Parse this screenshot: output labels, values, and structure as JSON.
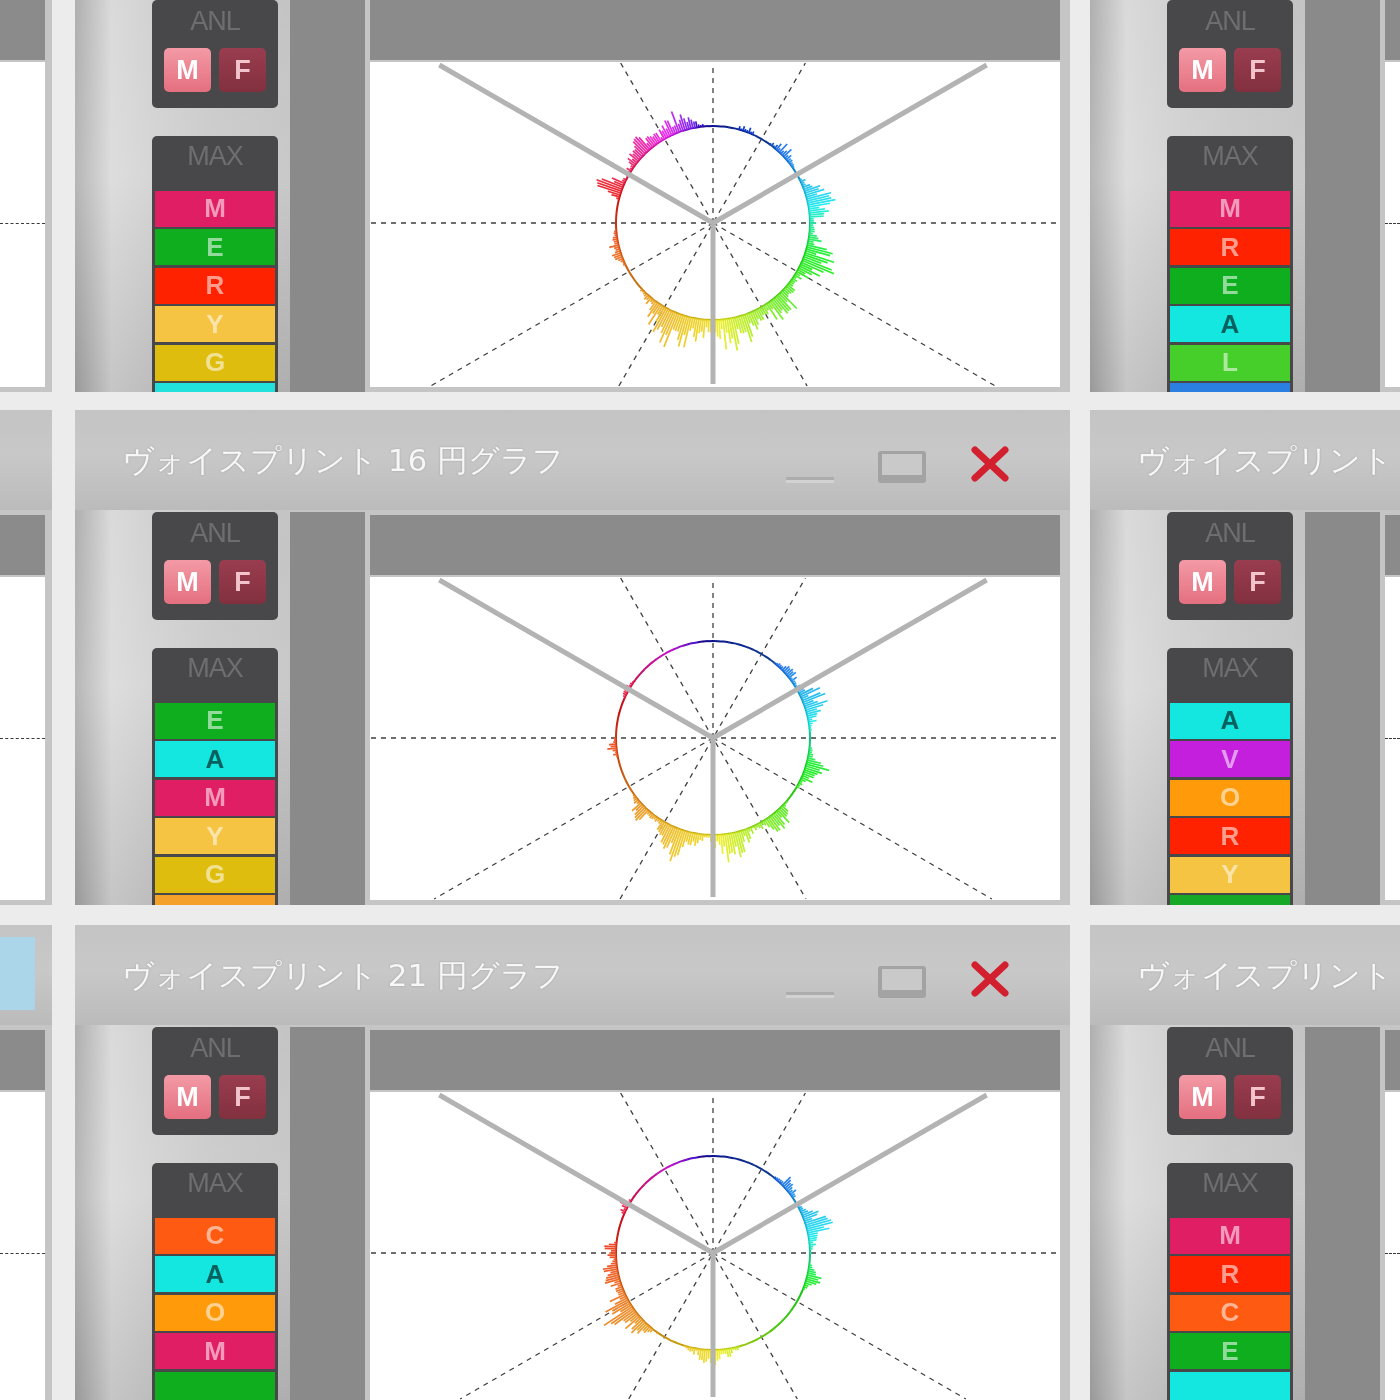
{
  "rows": [
    {
      "windows": [
        {
          "anl": {
            "label": "ANL",
            "options": [
              {
                "label": "M",
                "selected": true
              },
              {
                "label": "F",
                "selected": false
              }
            ]
          },
          "max": {
            "label": "MAX",
            "items": [
              {
                "label": "M",
                "color": "#e01e64"
              },
              {
                "label": "E",
                "color": "#0fae1e"
              },
              {
                "label": "R",
                "color": "#ff2200"
              },
              {
                "label": "Y",
                "color": "#f5c443"
              },
              {
                "label": "G",
                "color": "#dfbd0e"
              },
              {
                "color": "#22e0dc"
              }
            ]
          }
        },
        {
          "anl": {
            "label": "ANL",
            "options": [
              {
                "label": "M",
                "selected": true
              },
              {
                "label": "F",
                "selected": false
              }
            ]
          },
          "max": {
            "label": "MAX",
            "items": [
              {
                "label": "M",
                "color": "#e01e64"
              },
              {
                "label": "R",
                "color": "#ff2200"
              },
              {
                "label": "E",
                "color": "#0fae1e"
              },
              {
                "label": "A",
                "color": "#14e6e0"
              },
              {
                "label": "L",
                "color": "#46cf2a"
              },
              {
                "color": "#2a7fe0"
              }
            ]
          }
        }
      ]
    },
    {
      "left_title_bar": {
        "highlighted": false
      },
      "windows": [
        {
          "title": "ヴォイスプリント 16 円グラフ",
          "anl": {
            "label": "ANL",
            "options": [
              {
                "label": "M",
                "selected": true
              },
              {
                "label": "F",
                "selected": false
              }
            ]
          },
          "max": {
            "label": "MAX",
            "items": [
              {
                "label": "E",
                "color": "#0fae1e"
              },
              {
                "label": "A",
                "color": "#14e6e0"
              },
              {
                "label": "M",
                "color": "#e01e64"
              },
              {
                "label": "Y",
                "color": "#f5c443"
              },
              {
                "label": "G",
                "color": "#dfbd0e"
              },
              {
                "color": "#f4a12c"
              }
            ]
          }
        },
        {
          "title": "ヴォイスプリント",
          "anl": {
            "label": "ANL",
            "options": [
              {
                "label": "M",
                "selected": true
              },
              {
                "label": "F",
                "selected": false
              }
            ]
          },
          "max": {
            "label": "MAX",
            "items": [
              {
                "label": "A",
                "color": "#14e6e0"
              },
              {
                "label": "V",
                "color": "#c41fdc"
              },
              {
                "label": "O",
                "color": "#ff9a0a"
              },
              {
                "label": "R",
                "color": "#ff2200"
              },
              {
                "label": "Y",
                "color": "#f5c443"
              },
              {
                "color": "#18a828"
              }
            ]
          }
        }
      ]
    },
    {
      "left_title_bar": {
        "highlighted": true
      },
      "windows": [
        {
          "title": "ヴォイスプリント 21 円グラフ",
          "anl": {
            "label": "ANL",
            "options": [
              {
                "label": "M",
                "selected": true
              },
              {
                "label": "F",
                "selected": false
              }
            ]
          },
          "max": {
            "label": "MAX",
            "items": [
              {
                "label": "C",
                "color": "#ff5a12"
              },
              {
                "label": "A",
                "color": "#14e6e0"
              },
              {
                "label": "O",
                "color": "#ff9a0a"
              },
              {
                "label": "M",
                "color": "#e01e64"
              },
              {
                "color": "#0fae1e"
              }
            ]
          }
        },
        {
          "title": "ヴォイスプリント",
          "anl": {
            "label": "ANL",
            "options": [
              {
                "label": "M",
                "selected": true
              },
              {
                "label": "F",
                "selected": false
              }
            ]
          },
          "max": {
            "label": "MAX",
            "items": [
              {
                "label": "M",
                "color": "#e01e64"
              },
              {
                "label": "R",
                "color": "#ff2200"
              },
              {
                "label": "C",
                "color": "#ff5a12"
              },
              {
                "label": "E",
                "color": "#0fae1e"
              },
              {
                "color": "#14e6e0"
              }
            ]
          }
        }
      ]
    }
  ]
}
